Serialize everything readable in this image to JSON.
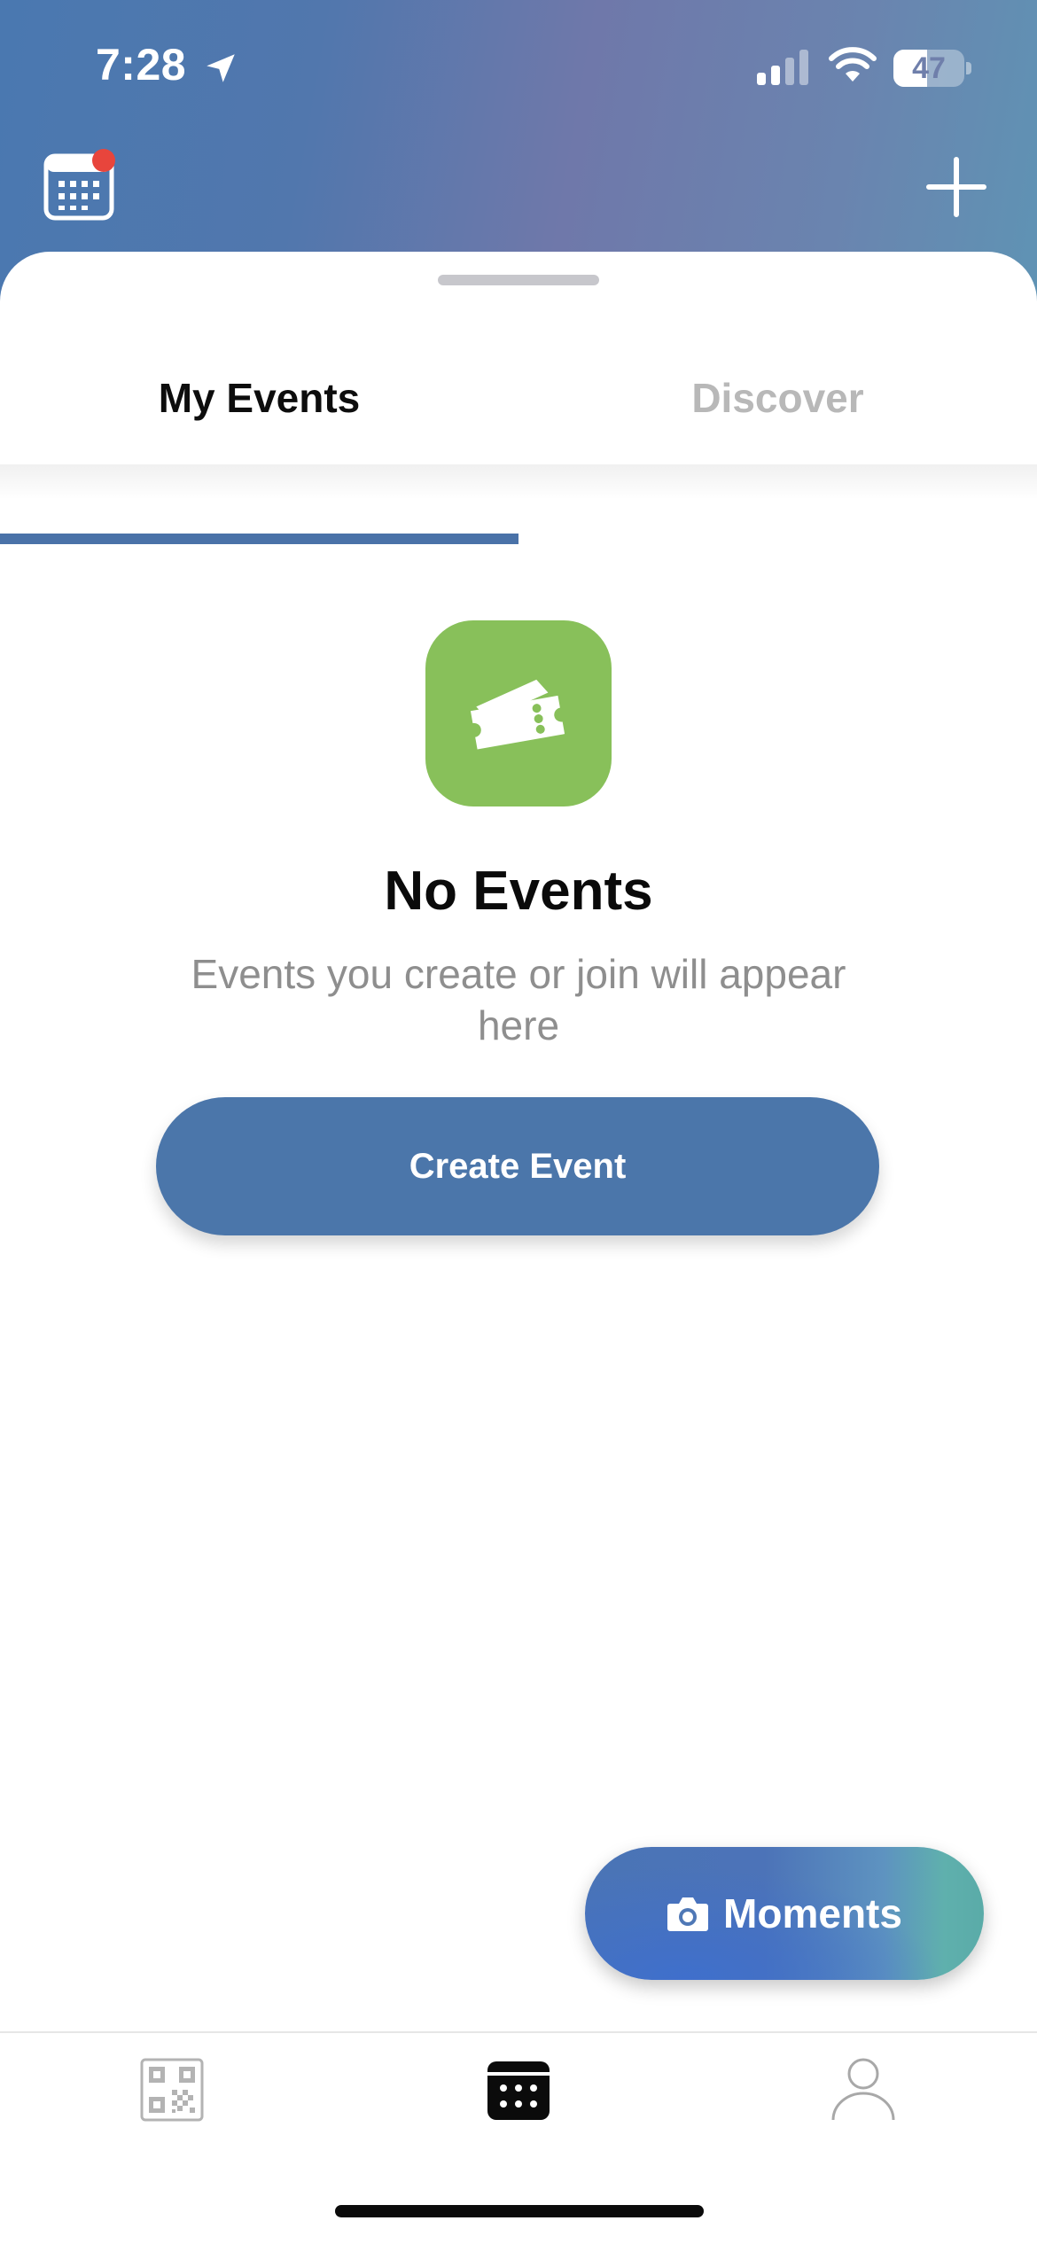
{
  "status_bar": {
    "time": "7:28",
    "battery_level": "47",
    "battery_fraction": 0.47,
    "icons": [
      "location-arrow-icon",
      "cellular-signal-icon",
      "wifi-icon",
      "battery-icon"
    ]
  },
  "header": {
    "left_icon": "calendar-icon",
    "left_badge_color": "#e8453c",
    "right_icon": "plus-icon"
  },
  "tabs": [
    {
      "label": "My Events",
      "active": true
    },
    {
      "label": "Discover",
      "active": false
    }
  ],
  "empty_state": {
    "icon": "ticket-icon",
    "icon_bg": "#88c05a",
    "title": "No Events",
    "subtitle": "Events you create or join will appear here",
    "button_label": "Create Event"
  },
  "fab": {
    "icon": "camera-icon",
    "label": "Moments"
  },
  "tab_bar": {
    "items": [
      {
        "icon": "qr-code-icon",
        "active": false
      },
      {
        "icon": "events-icon",
        "active": true
      },
      {
        "icon": "profile-icon",
        "active": false
      }
    ]
  },
  "colors": {
    "accent": "#4b76aa",
    "tab_indicator": "#4a72a8",
    "inactive_tab": "#b8b8b8"
  }
}
